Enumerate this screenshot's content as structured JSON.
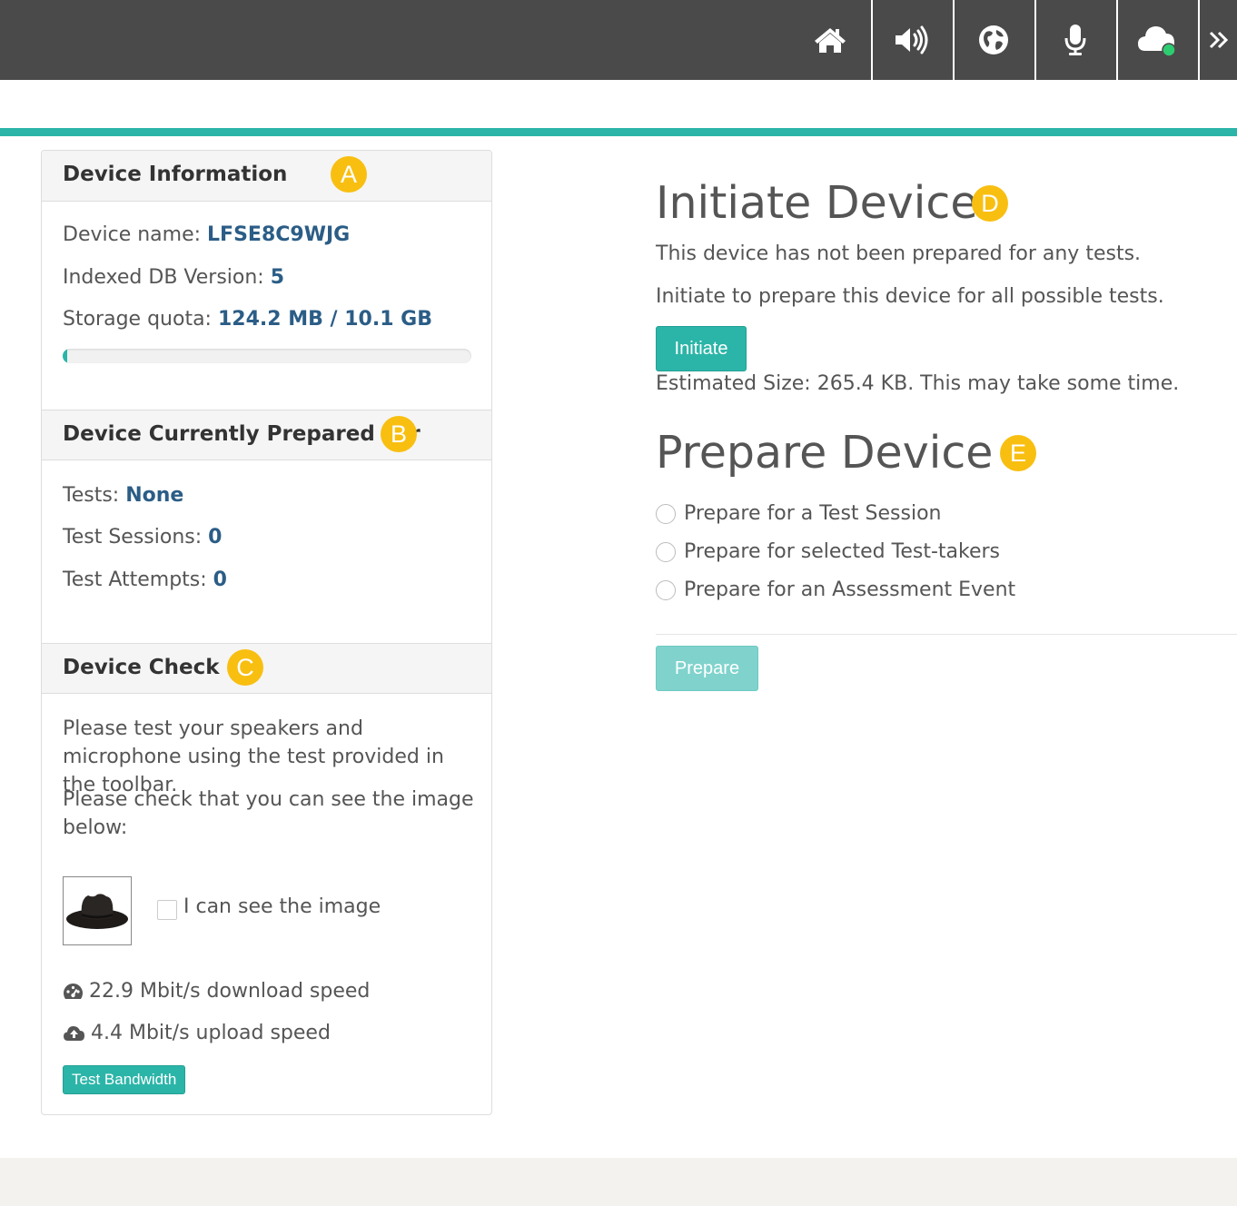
{
  "toolbar": {
    "buttons": [
      {
        "icon": "home-icon"
      },
      {
        "icon": "speaker-icon"
      },
      {
        "icon": "globe-icon"
      },
      {
        "icon": "microphone-icon"
      },
      {
        "icon": "cloud-online-icon",
        "status_color": "#2ecc71"
      },
      {
        "icon": "double-chevron-right-icon"
      }
    ]
  },
  "device_info": {
    "title": "Device Information",
    "marker": "A",
    "device_name_label": "Device name: ",
    "device_name": "LFSE8C9WJG",
    "db_version_label": "Indexed DB Version: ",
    "db_version": "5",
    "storage_label": "Storage quota: ",
    "storage_value": "124.2 MB / 10.1 GB",
    "storage_fraction": 0.012
  },
  "prepared_for": {
    "title": "Device Currently Prepared For",
    "marker": "B",
    "tests_label": "Tests: ",
    "tests": "None",
    "sessions_label": "Test Sessions: ",
    "sessions": "0",
    "attempts_label": "Test Attempts: ",
    "attempts": "0"
  },
  "device_check": {
    "title": "Device Check",
    "marker": "C",
    "instructions_1": "Please test your speakers and microphone using the test provided in the toolbar.",
    "instructions_2": "Please check that you can see the image below:",
    "image_confirm_label": "I can see the image",
    "download_speed": "22.9 Mbit/s download speed",
    "upload_speed": "4.4 Mbit/s upload speed",
    "test_bandwidth_label": "Test Bandwidth"
  },
  "initiate": {
    "title": "Initiate Device",
    "marker": "D",
    "status_text": "This device has not been prepared for any tests.",
    "hint_text": "Initiate to prepare this device for all possible tests.",
    "button_label": "Initiate",
    "estimate_text": "Estimated Size: 265.4 KB. This may take some time."
  },
  "prepare": {
    "title": "Prepare Device",
    "marker": "E",
    "options": [
      "Prepare for a Test Session",
      "Prepare for selected Test-takers",
      "Prepare for an Assessment Event"
    ],
    "button_label": "Prepare"
  },
  "colors": {
    "accent": "#2bb5a8",
    "toolbar": "#4a4a4a",
    "marker": "#f8bf11",
    "value_text": "#2b5d86"
  }
}
